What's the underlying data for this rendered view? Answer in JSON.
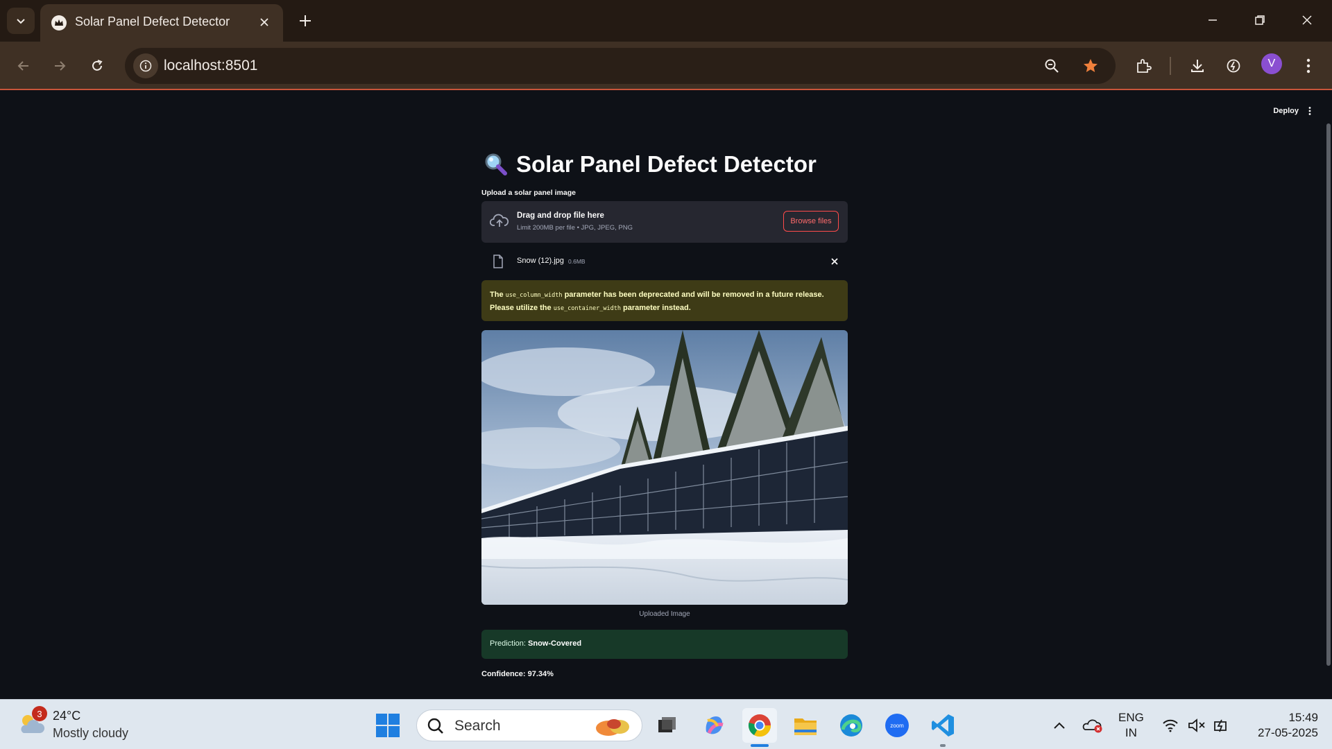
{
  "browser": {
    "tab_title": "Solar Panel Defect Detector",
    "url": "localhost:8501",
    "profile_initial": "V"
  },
  "app": {
    "deploy_label": "Deploy",
    "title": "Solar Panel Defect Detector",
    "upload_label": "Upload a solar panel image",
    "dropzone_title": "Drag and drop file here",
    "dropzone_sub": "Limit 200MB per file • JPG, JPEG, PNG",
    "browse_label": "Browse files",
    "file_name": "Snow (12).jpg",
    "file_size": "0.6MB",
    "warning": {
      "p1": "The ",
      "code1": "use_column_width",
      "p2": " parameter has been deprecated and will be removed in a future release. Please utilize the ",
      "code2": "use_container_width",
      "p3": " parameter instead."
    },
    "image_caption": "Uploaded Image",
    "prediction_label": "Prediction: ",
    "prediction_value": "Snow-Covered",
    "confidence_text": "Confidence: 97.34%"
  },
  "taskbar": {
    "weather_badge": "3",
    "weather_temp": "24°C",
    "weather_desc": "Mostly cloudy",
    "search_placeholder": "Search",
    "lang_line1": "ENG",
    "lang_line2": "IN",
    "time": "15:49",
    "date": "27-05-2025"
  },
  "colors": {
    "accent": "#ff4b4b",
    "success_bg": "#173928",
    "warning_bg": "#3e3b16",
    "page_bg": "#0e1117",
    "chrome_bg": "#3f3024"
  }
}
